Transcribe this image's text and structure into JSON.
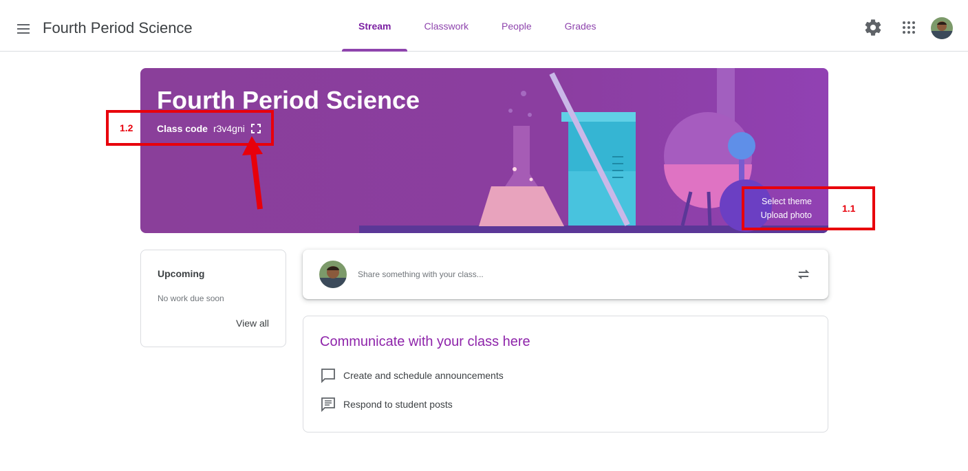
{
  "header": {
    "menu_icon": "hamburger-menu-icon",
    "title": "Fourth Period Science",
    "tabs": [
      {
        "label": "Stream",
        "active": true
      },
      {
        "label": "Classwork",
        "active": false
      },
      {
        "label": "People",
        "active": false
      },
      {
        "label": "Grades",
        "active": false
      }
    ],
    "settings_icon": "gear-icon",
    "apps_icon": "apps-grid-icon",
    "avatar_icon": "user-avatar"
  },
  "banner": {
    "title": "Fourth Period Science",
    "class_code_label": "Class code",
    "class_code": "r3v4gni",
    "expand_icon": "fullscreen-expand-icon",
    "select_theme": "Select theme",
    "upload_photo": "Upload photo",
    "color": "#8a3f9a"
  },
  "annotations": {
    "box_1_label": "1.2",
    "box_2_label": "1.1",
    "color": "#e8000b"
  },
  "upcoming": {
    "title": "Upcoming",
    "status": "No work due soon",
    "view_all": "View all"
  },
  "share": {
    "placeholder": "Share something with your class...",
    "repost_icon": "repost-icon"
  },
  "communicate": {
    "title": "Communicate with your class here",
    "items": [
      {
        "icon": "comment-icon",
        "label": "Create and schedule announcements"
      },
      {
        "icon": "message-list-icon",
        "label": "Respond to student posts"
      }
    ]
  },
  "accent_color": "#8e44ad"
}
